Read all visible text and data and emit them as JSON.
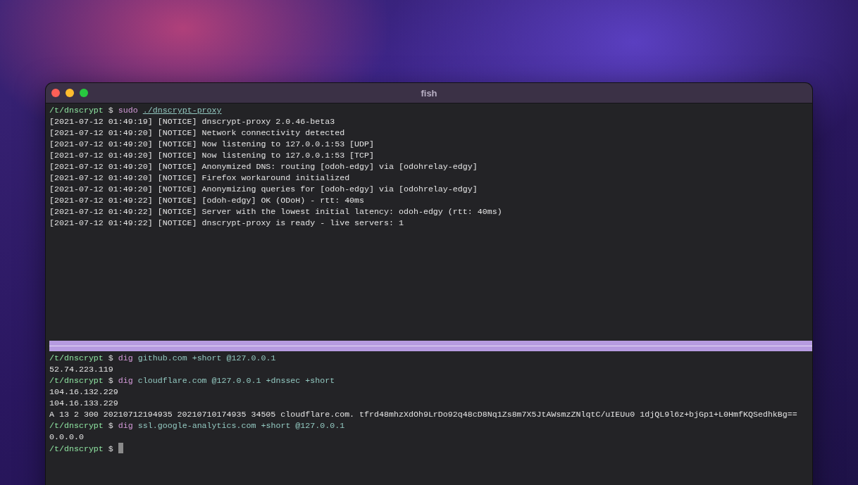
{
  "window": {
    "title": "fish"
  },
  "panes": [
    {
      "lines": [
        {
          "kind": "prompt",
          "cwd": "/t/dnscrypt",
          "symbol": "$",
          "command": "sudo",
          "args": "./dnscrypt-proxy",
          "underlined": true
        },
        {
          "kind": "output",
          "text": "[2021-07-12 01:49:19] [NOTICE] dnscrypt-proxy 2.0.46-beta3"
        },
        {
          "kind": "output",
          "text": "[2021-07-12 01:49:20] [NOTICE] Network connectivity detected"
        },
        {
          "kind": "output",
          "text": "[2021-07-12 01:49:20] [NOTICE] Now listening to 127.0.0.1:53 [UDP]"
        },
        {
          "kind": "output",
          "text": "[2021-07-12 01:49:20] [NOTICE] Now listening to 127.0.0.1:53 [TCP]"
        },
        {
          "kind": "output",
          "text": "[2021-07-12 01:49:20] [NOTICE] Anonymized DNS: routing [odoh-edgy] via [odohrelay-edgy]"
        },
        {
          "kind": "output",
          "text": "[2021-07-12 01:49:20] [NOTICE] Firefox workaround initialized"
        },
        {
          "kind": "output",
          "text": "[2021-07-12 01:49:20] [NOTICE] Anonymizing queries for [odoh-edgy] via [odohrelay-edgy]"
        },
        {
          "kind": "output",
          "text": "[2021-07-12 01:49:22] [NOTICE] [odoh-edgy] OK (ODoH) - rtt: 40ms"
        },
        {
          "kind": "output",
          "text": "[2021-07-12 01:49:22] [NOTICE] Server with the lowest initial latency: odoh-edgy (rtt: 40ms)"
        },
        {
          "kind": "output",
          "text": "[2021-07-12 01:49:22] [NOTICE] dnscrypt-proxy is ready - live servers: 1"
        }
      ]
    },
    {
      "lines": [
        {
          "kind": "prompt",
          "cwd": "/t/dnscrypt",
          "symbol": "$",
          "command": "dig",
          "args": "github.com +short @127.0.0.1",
          "underlined": false
        },
        {
          "kind": "output",
          "text": "52.74.223.119"
        },
        {
          "kind": "prompt",
          "cwd": "/t/dnscrypt",
          "symbol": "$",
          "command": "dig",
          "args": "cloudflare.com @127.0.0.1 +dnssec +short",
          "underlined": false
        },
        {
          "kind": "output",
          "text": "104.16.132.229"
        },
        {
          "kind": "output",
          "text": "104.16.133.229"
        },
        {
          "kind": "output",
          "text": "A 13 2 300 20210712194935 20210710174935 34505 cloudflare.com. tfrd48mhzXdOh9LrDo92q48cD8Nq1Zs8m7X5JtAWsmzZNlqtC/uIEUu0 1djQL9l6z+bjGp1+L0HmfKQSedhkBg=="
        },
        {
          "kind": "prompt",
          "cwd": "/t/dnscrypt",
          "symbol": "$",
          "command": "dig",
          "args": "ssl.google-analytics.com +short @127.0.0.1",
          "underlined": false
        },
        {
          "kind": "output",
          "text": "0.0.0.0"
        },
        {
          "kind": "prompt",
          "cwd": "/t/dnscrypt",
          "symbol": "$",
          "cursor": true
        }
      ]
    }
  ]
}
